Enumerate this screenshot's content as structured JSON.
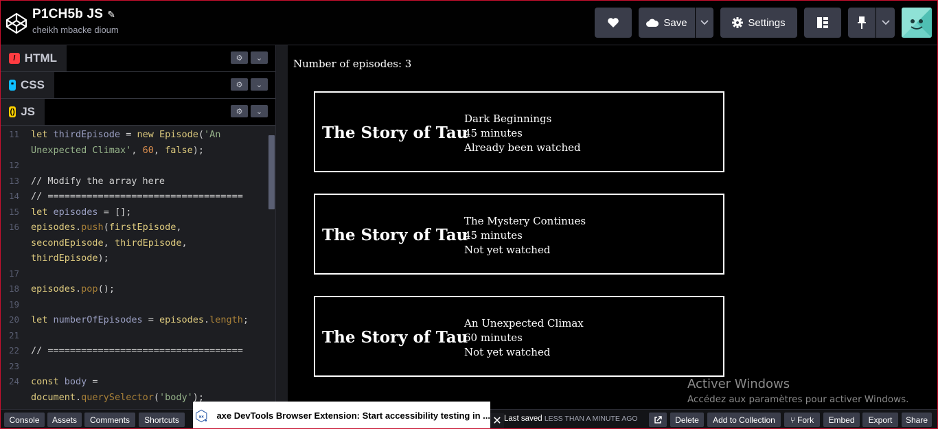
{
  "header": {
    "title": "P1CH5b JS",
    "author": "cheikh mbacke dioum",
    "save_label": "Save",
    "settings_label": "Settings"
  },
  "editors": {
    "html_label": "HTML",
    "css_label": "CSS",
    "js_label": "JS"
  },
  "code_lines": [
    {
      "n": "",
      "t": "let thirdEpisode = new Episode('An"
    },
    {
      "n": "11",
      "t": ""
    },
    {
      "n": "",
      "t": ""
    },
    {
      "n": "12",
      "t": ""
    },
    {
      "n": "13",
      "t": "// Modify the array here"
    },
    {
      "n": "14",
      "t": "// ==================================="
    },
    {
      "n": "15",
      "t": "let episodes = [];"
    },
    {
      "n": "16",
      "t": "episodes.push(firstEpisode,"
    },
    {
      "n": "",
      "t": "secondEpisode, thirdEpisode,"
    },
    {
      "n": "",
      "t": "thirdEpisode);"
    },
    {
      "n": "17",
      "t": ""
    },
    {
      "n": "18",
      "t": "episodes.pop();"
    },
    {
      "n": "19",
      "t": ""
    },
    {
      "n": "20",
      "t": "let numberOfEpisodes = episodes.length;"
    },
    {
      "n": "21",
      "t": ""
    },
    {
      "n": "22",
      "t": "// ==================================="
    },
    {
      "n": "23",
      "t": ""
    },
    {
      "n": "24",
      "t": "const body ="
    },
    {
      "n": "",
      "t": "document.querySelector('body');"
    }
  ],
  "preview": {
    "count_label": "Number of episodes: 3",
    "episodes": [
      {
        "show": "The Story of Tau",
        "title": "Dark Beginnings",
        "duration": "45 minutes",
        "status": "Already been watched"
      },
      {
        "show": "The Story of Tau",
        "title": "The Mystery Continues",
        "duration": "45 minutes",
        "status": "Not yet watched"
      },
      {
        "show": "The Story of Tau",
        "title": "An Unexpected Climax",
        "duration": "60 minutes",
        "status": "Not yet watched"
      }
    ]
  },
  "windows_watermark": {
    "line1": "Activer Windows",
    "line2": "Accédez aux paramètres pour activer Windows."
  },
  "footer": {
    "console": "Console",
    "assets": "Assets",
    "comments": "Comments",
    "shortcuts": "Shortcuts",
    "last_saved": "Last saved",
    "last_saved_when": "LESS THAN A MINUTE AGO",
    "delete": "Delete",
    "add_to_collection": "Add to Collection",
    "fork": "Fork",
    "embed": "Embed",
    "export": "Export",
    "share": "Share"
  },
  "extension_popup": {
    "text": "axe DevTools Browser Extension: Start accessibility testing in ...",
    "logo_text": "ax"
  },
  "colors": {
    "accent_border": "#c8102e",
    "header_button": "#3a3d4a",
    "editor_bg": "#1d1e22"
  }
}
